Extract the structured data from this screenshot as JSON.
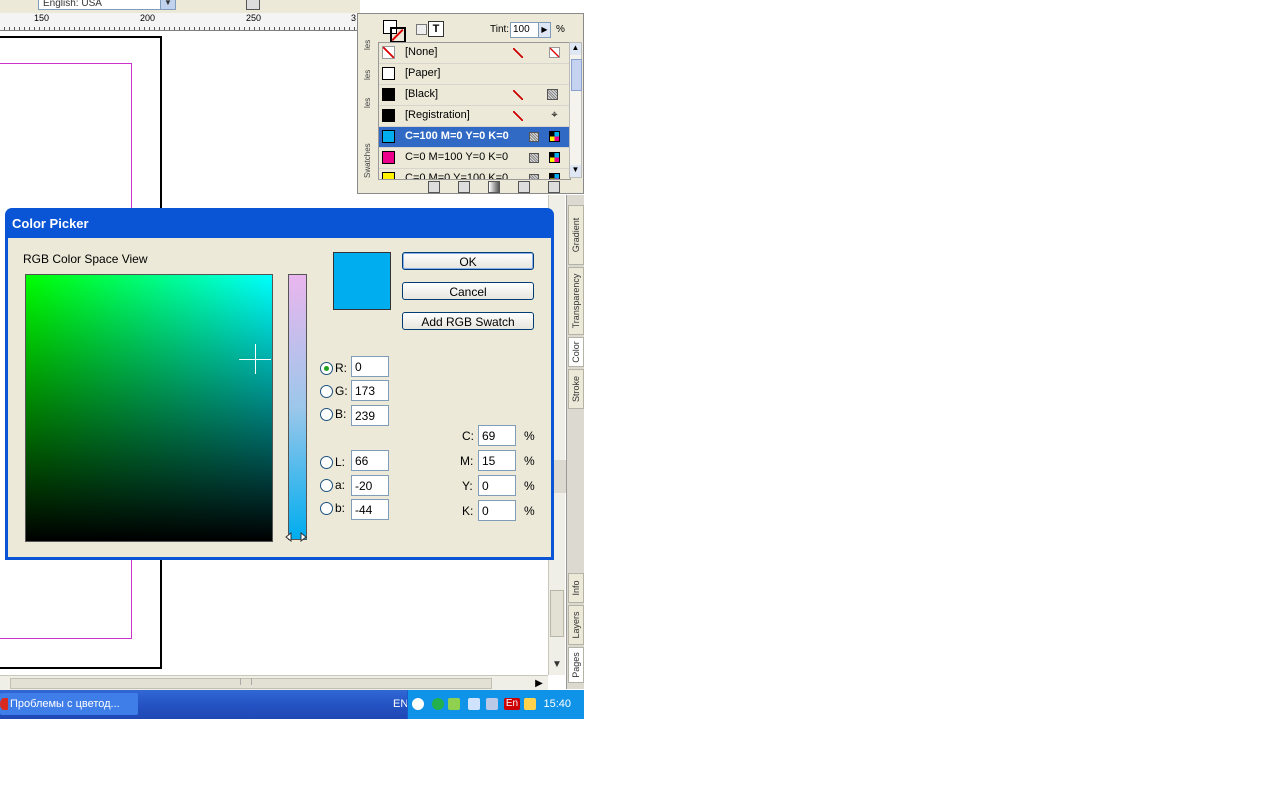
{
  "top": {
    "language": "English: USA"
  },
  "ruler": {
    "labels": [
      "150",
      "200",
      "250",
      "3"
    ]
  },
  "swatches_panel": {
    "side_tabs": [
      "les",
      "les",
      "les",
      "Swatches"
    ],
    "tint_label": "Tint:",
    "tint_value": "100",
    "tint_unit": "%",
    "rows": [
      {
        "name": "[None]",
        "color": "#ffffff"
      },
      {
        "name": "[Paper]",
        "color": "#ffffff"
      },
      {
        "name": "[Black]",
        "color": "#000000"
      },
      {
        "name": "[Registration]",
        "color": "#000000"
      },
      {
        "name": "C=100 M=0 Y=0 K=0",
        "color": "#00adef",
        "selected": true
      },
      {
        "name": "C=0 M=100 Y=0 K=0",
        "color": "#ec008c"
      },
      {
        "name": "C=0 M=0 Y=100 K=0",
        "color": "#fff200"
      }
    ]
  },
  "side_tabs": [
    "Gradient",
    "Transparency",
    "Color",
    "Stroke",
    "Info",
    "Layers",
    "Pages"
  ],
  "color_picker": {
    "title": "Color Picker",
    "space_label": "RGB Color Space View",
    "preview_color": "#00adef",
    "ok_label": "OK",
    "cancel_label": "Cancel",
    "add_swatch_label": "Add RGB Swatch",
    "rgb": {
      "r_label": "R:",
      "r": "0",
      "g_label": "G:",
      "g": "173",
      "b_label": "B:",
      "b": "239"
    },
    "lab": {
      "l_label": "L:",
      "l": "66",
      "a_label": "a:",
      "a": "-20",
      "b_label": "b:",
      "b": "-44"
    },
    "cmyk": {
      "c_label": "C:",
      "c": "69",
      "m_label": "M:",
      "m": "15",
      "y_label": "Y:",
      "y": "0",
      "k_label": "K:",
      "k": "0",
      "unit": "%"
    }
  },
  "taskbar": {
    "task_label": "Проблемы с цветод...",
    "language": "EN",
    "tray_lang": "En",
    "clock": "15:40"
  }
}
